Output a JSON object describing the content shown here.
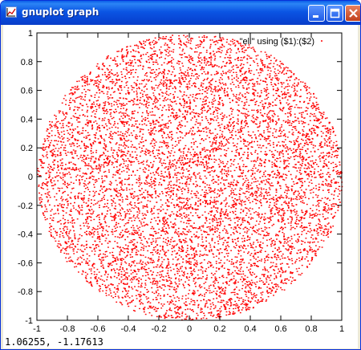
{
  "window": {
    "title": "gnuplot graph",
    "colors": {
      "titlebar": "#0a55e4",
      "close": "#d0502a"
    }
  },
  "plot": {
    "legend_label": "\"ell\" using ($1):($2)",
    "coordinate_readout": "1.06255, -1.17613"
  },
  "chart_data": {
    "type": "scatter",
    "title": "",
    "xlabel": "",
    "ylabel": "",
    "xlim": [
      -1,
      1
    ],
    "ylim": [
      -1,
      1
    ],
    "x_tick_labels": [
      "-1",
      "-0.8",
      "-0.6",
      "-0.4",
      "-0.2",
      "0",
      "0.2",
      "0.4",
      "0.6",
      "0.8",
      "1"
    ],
    "y_tick_labels": [
      "1",
      "0.8",
      "0.6",
      "0.4",
      "0.2",
      "0",
      "-0.2",
      "-0.4",
      "-0.6",
      "-0.8",
      "-1"
    ],
    "grid": false,
    "legend_position": "top-right",
    "series": [
      {
        "name": "\"ell\" using ($1):($2)",
        "color": "#ff0000",
        "description_shape": "uniform points filling ellipse",
        "center": [
          0,
          0
        ],
        "radius_x": 1.0,
        "radius_y": 1.0,
        "approx_point_count": 60000
      }
    ]
  }
}
